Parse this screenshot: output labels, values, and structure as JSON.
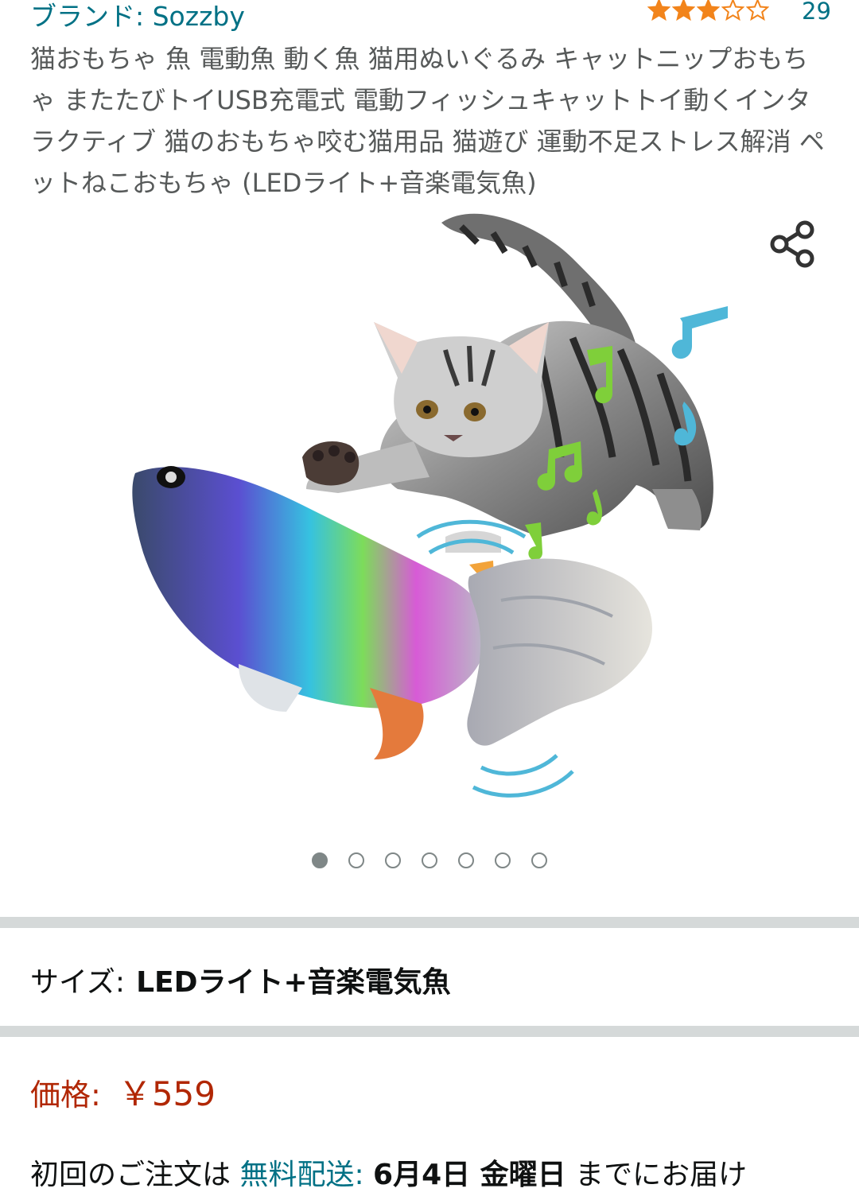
{
  "brand": {
    "prefix": "ブランド: ",
    "name": "Sozzby",
    "accent": "#007185"
  },
  "rating": {
    "stars_filled": 3,
    "stars_total": 5,
    "review_count": "29",
    "star_color": "#f2841b"
  },
  "title": "猫おもちゃ 魚 電動魚 動く魚 猫用ぬいぐるみ キャットニップおもちゃ またたびトイUSB充電式 電動フィッシュキャットトイ動くインタラクティブ 猫のおもちゃ咬む猫用品 猫遊び 運動不足ストレス解消 ペットねこおもちゃ (LEDライト+音楽電気魚)",
  "carousel": {
    "image_count": 7,
    "active_index": 0,
    "share_icon": "share-icon"
  },
  "size": {
    "label": "サイズ:",
    "value": "LEDライト+音楽電気魚"
  },
  "price": {
    "label": "価格:",
    "value": "￥559",
    "color": "#b12704"
  },
  "delivery": {
    "prefix": "初回のご注文は ",
    "free_shipping": "無料配送:",
    "date": "6月4日 金曜日",
    "suffix": " までにお届け"
  }
}
